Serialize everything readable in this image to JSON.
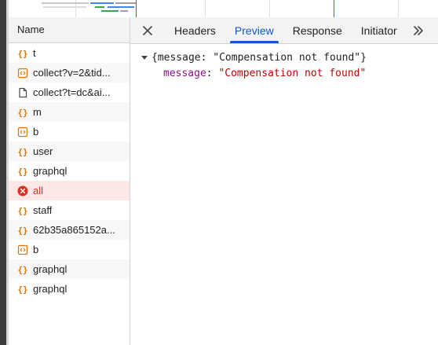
{
  "timeline": {},
  "request_list": {
    "header": "Name",
    "rows": [
      {
        "label": "t",
        "type": "fetch",
        "state": "normal"
      },
      {
        "label": "collect?v=2&tid...",
        "type": "script",
        "state": "normal"
      },
      {
        "label": "collect?t=dc&ai...",
        "type": "document",
        "state": "normal"
      },
      {
        "label": "m",
        "type": "fetch",
        "state": "normal"
      },
      {
        "label": "b",
        "type": "script",
        "state": "normal"
      },
      {
        "label": "user",
        "type": "fetch",
        "state": "normal"
      },
      {
        "label": "graphql",
        "type": "fetch",
        "state": "normal"
      },
      {
        "label": "all",
        "type": "error",
        "state": "error"
      },
      {
        "label": "staff",
        "type": "fetch",
        "state": "normal"
      },
      {
        "label": "62b35a865152a...",
        "type": "fetch",
        "state": "normal"
      },
      {
        "label": "b",
        "type": "script",
        "state": "normal"
      },
      {
        "label": "graphql",
        "type": "fetch",
        "state": "normal"
      },
      {
        "label": "graphql",
        "type": "fetch",
        "state": "normal"
      }
    ]
  },
  "detail_tabs": {
    "close_icon": "close-icon",
    "tabs": [
      "Headers",
      "Preview",
      "Response",
      "Initiator"
    ],
    "active": "Preview",
    "more_icon": "chevron-double-right-icon"
  },
  "preview": {
    "summary": "{message: \"Compensation not found\"}",
    "property_key": "message",
    "property_sep": ": ",
    "property_value": "\"Compensation not found\""
  },
  "colors": {
    "accent": "#0b57d0",
    "fetch_icon": "#e37400",
    "error": "#d93025",
    "error_row_bg": "#fce8e6",
    "prop_key": "#881280",
    "prop_value": "#c80000"
  }
}
